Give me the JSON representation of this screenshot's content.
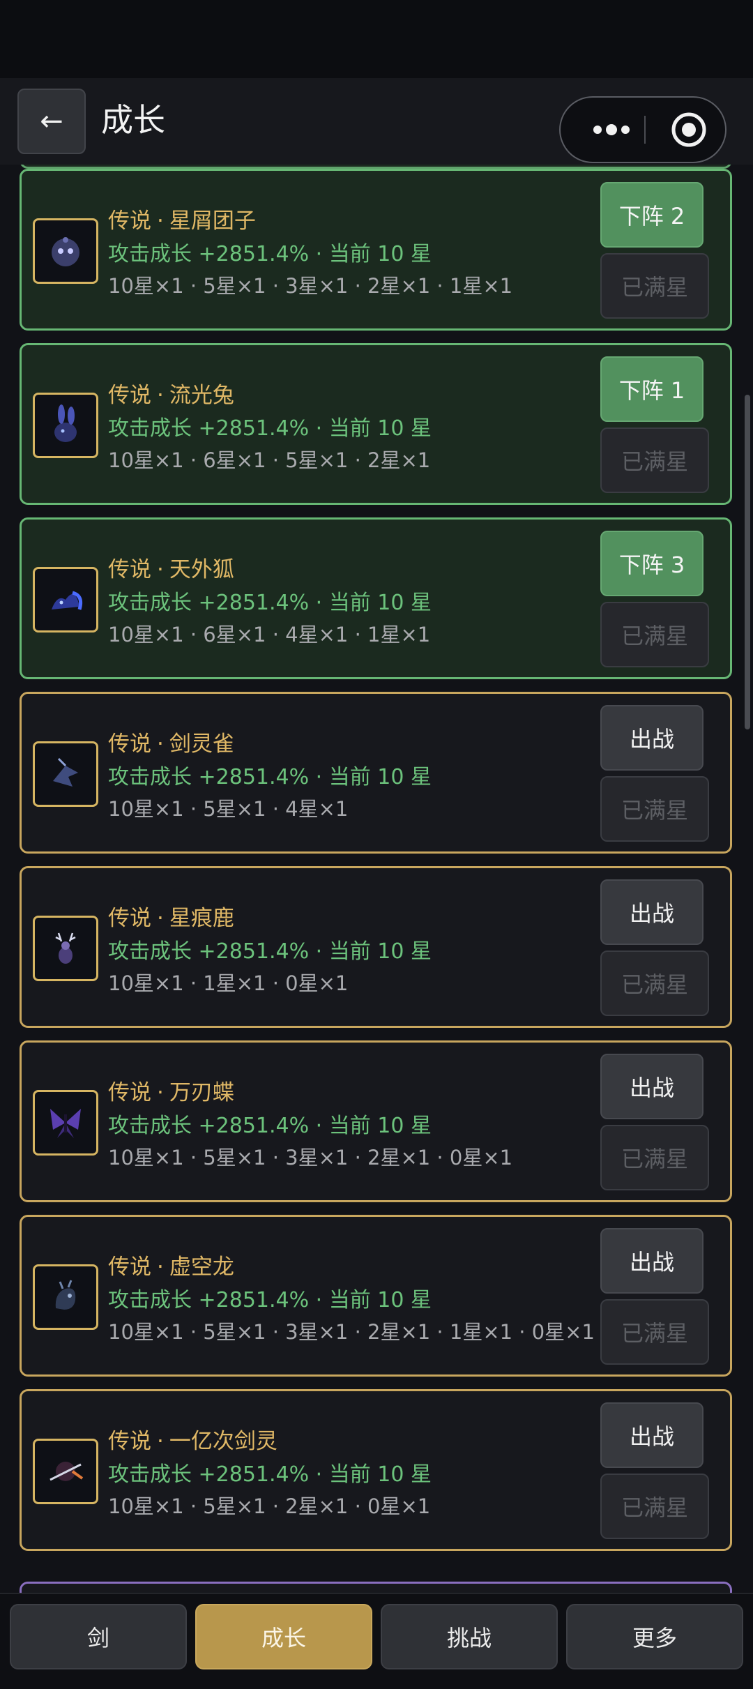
{
  "header": {
    "back_label": "←",
    "title": "成长"
  },
  "cards": [
    {
      "rarity": "传说",
      "name": "星屑团子",
      "growth": "攻击成长 +2851.4% · 当前 10 星",
      "stars": "10星×1 · 5星×1 · 3星×1 · 2星×1 · 1星×1",
      "deploy_label": "下阵 2",
      "max_label": "已满星",
      "active": true,
      "icon": "round-creature-icon"
    },
    {
      "rarity": "传说",
      "name": "流光兔",
      "growth": "攻击成长 +2851.4% · 当前 10 星",
      "stars": "10星×1 · 6星×1 · 5星×1 · 2星×1",
      "deploy_label": "下阵 1",
      "max_label": "已满星",
      "active": true,
      "icon": "rabbit-icon"
    },
    {
      "rarity": "传说",
      "name": "天外狐",
      "growth": "攻击成长 +2851.4% · 当前 10 星",
      "stars": "10星×1 · 6星×1 · 4星×1 · 1星×1",
      "deploy_label": "下阵 3",
      "max_label": "已满星",
      "active": true,
      "icon": "fox-icon"
    },
    {
      "rarity": "传说",
      "name": "剑灵雀",
      "growth": "攻击成长 +2851.4% · 当前 10 星",
      "stars": "10星×1 · 5星×1 · 4星×1",
      "deploy_label": "出战",
      "max_label": "已满星",
      "active": false,
      "icon": "sparrow-icon"
    },
    {
      "rarity": "传说",
      "name": "星痕鹿",
      "growth": "攻击成长 +2851.4% · 当前 10 星",
      "stars": "10星×1 · 1星×1 · 0星×1",
      "deploy_label": "出战",
      "max_label": "已满星",
      "active": false,
      "icon": "deer-icon"
    },
    {
      "rarity": "传说",
      "name": "万刃蝶",
      "growth": "攻击成长 +2851.4% · 当前 10 星",
      "stars": "10星×1 · 5星×1 · 3星×1 · 2星×1 · 0星×1",
      "deploy_label": "出战",
      "max_label": "已满星",
      "active": false,
      "icon": "butterfly-icon"
    },
    {
      "rarity": "传说",
      "name": "虚空龙",
      "growth": "攻击成长 +2851.4% · 当前 10 星",
      "stars": "10星×1 · 5星×1 · 3星×1 · 2星×1 · 1星×1 · 0星×1",
      "deploy_label": "出战",
      "max_label": "已满星",
      "active": false,
      "icon": "dragon-icon"
    },
    {
      "rarity": "传说",
      "name": "一亿次剑灵",
      "growth": "攻击成长 +2851.4% · 当前 10 星",
      "stars": "10星×1 · 5星×1 · 2星×1 · 0星×1",
      "deploy_label": "出战",
      "max_label": "已满星",
      "active": false,
      "icon": "sword-spirit-icon"
    }
  ],
  "tabs": [
    {
      "label": "剑",
      "active": false
    },
    {
      "label": "成长",
      "active": true
    },
    {
      "label": "挑战",
      "active": false
    },
    {
      "label": "更多",
      "active": false
    }
  ],
  "colors": {
    "gold": "#c8a65e",
    "green": "#67b774",
    "accent_tab": "#b8974c"
  }
}
